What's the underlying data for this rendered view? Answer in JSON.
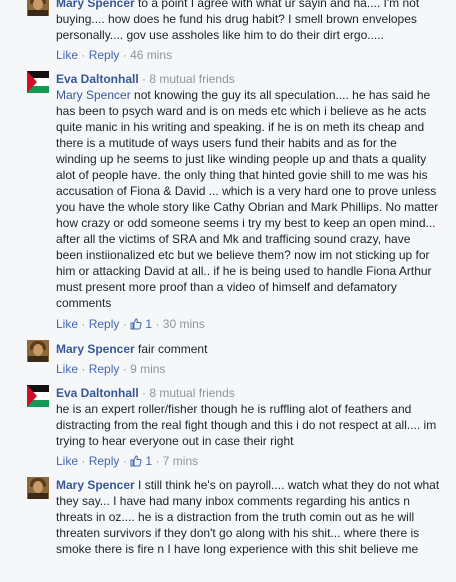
{
  "comments": [
    {
      "author": "Mary Spencer",
      "text": "to a point I agree with what ur sayin and ha.... I'm not buying.... how does he fund his drug habit? I smell brown envelopes personally.... gov use assholes like him to do their dirt ergo.....",
      "like_label": "Like",
      "reply_label": "Reply",
      "time": "46 mins"
    },
    {
      "author": "Eva Daltonhall",
      "mutual": "8 mutual friends",
      "mention": "Mary Spencer",
      "text": "not knowing the guy its all speculation.... he has said he has been to psych ward and is on meds etc which i believe as he acts quite manic in his writing and speaking. if he is on meth its cheap and there is a mutitude of ways users fund their habits and as for the winding up he seems to just like winding people up and thats a quality alot of people have. the only thing that hinted govie shill to me was his accusation of Fiona & David ... which is a very hard one to prove unless you have the whole story like Cathy Obrian and Mark Phillips. No matter how crazy or odd someone seems i try my best to keep an open mind... after all the victims of SRA and Mk and trafficing sound crazy, have been instiionalized etc but we believe them? now im not sticking up for him or attacking David at all.. if he is being used to handle Fiona Arthur must present more proof than a video of himself and defamatory comments",
      "like_label": "Like",
      "reply_label": "Reply",
      "likes": "1",
      "time": "30 mins"
    },
    {
      "author": "Mary Spencer",
      "text": "fair comment",
      "like_label": "Like",
      "reply_label": "Reply",
      "time": "9 mins"
    },
    {
      "author": "Eva Daltonhall",
      "mutual": "8 mutual friends",
      "text": "he is an expert roller/fisher though he is ruffling alot of feathers and distracting from the real fight though and this i do not respect at all.... im trying to hear everyone out in case their right",
      "like_label": "Like",
      "reply_label": "Reply",
      "likes": "1",
      "time": "7 mins"
    },
    {
      "author": "Mary Spencer",
      "text": "I still think he's on payroll.... watch what they do not what they say... I have had many inbox comments regarding his antics n threats in oz.... he is a distraction from the truth comin out as he will threaten survivors if they don't go along with his shit... where there is smoke there is fire n I have long experience with this shit believe me"
    }
  ],
  "colors": {
    "background": "#f6f7f9",
    "name": "#365899",
    "link": "#4267b2",
    "meta": "#90949c",
    "text": "#1d2129"
  },
  "icons": {
    "like": "thumbs-up-icon"
  }
}
